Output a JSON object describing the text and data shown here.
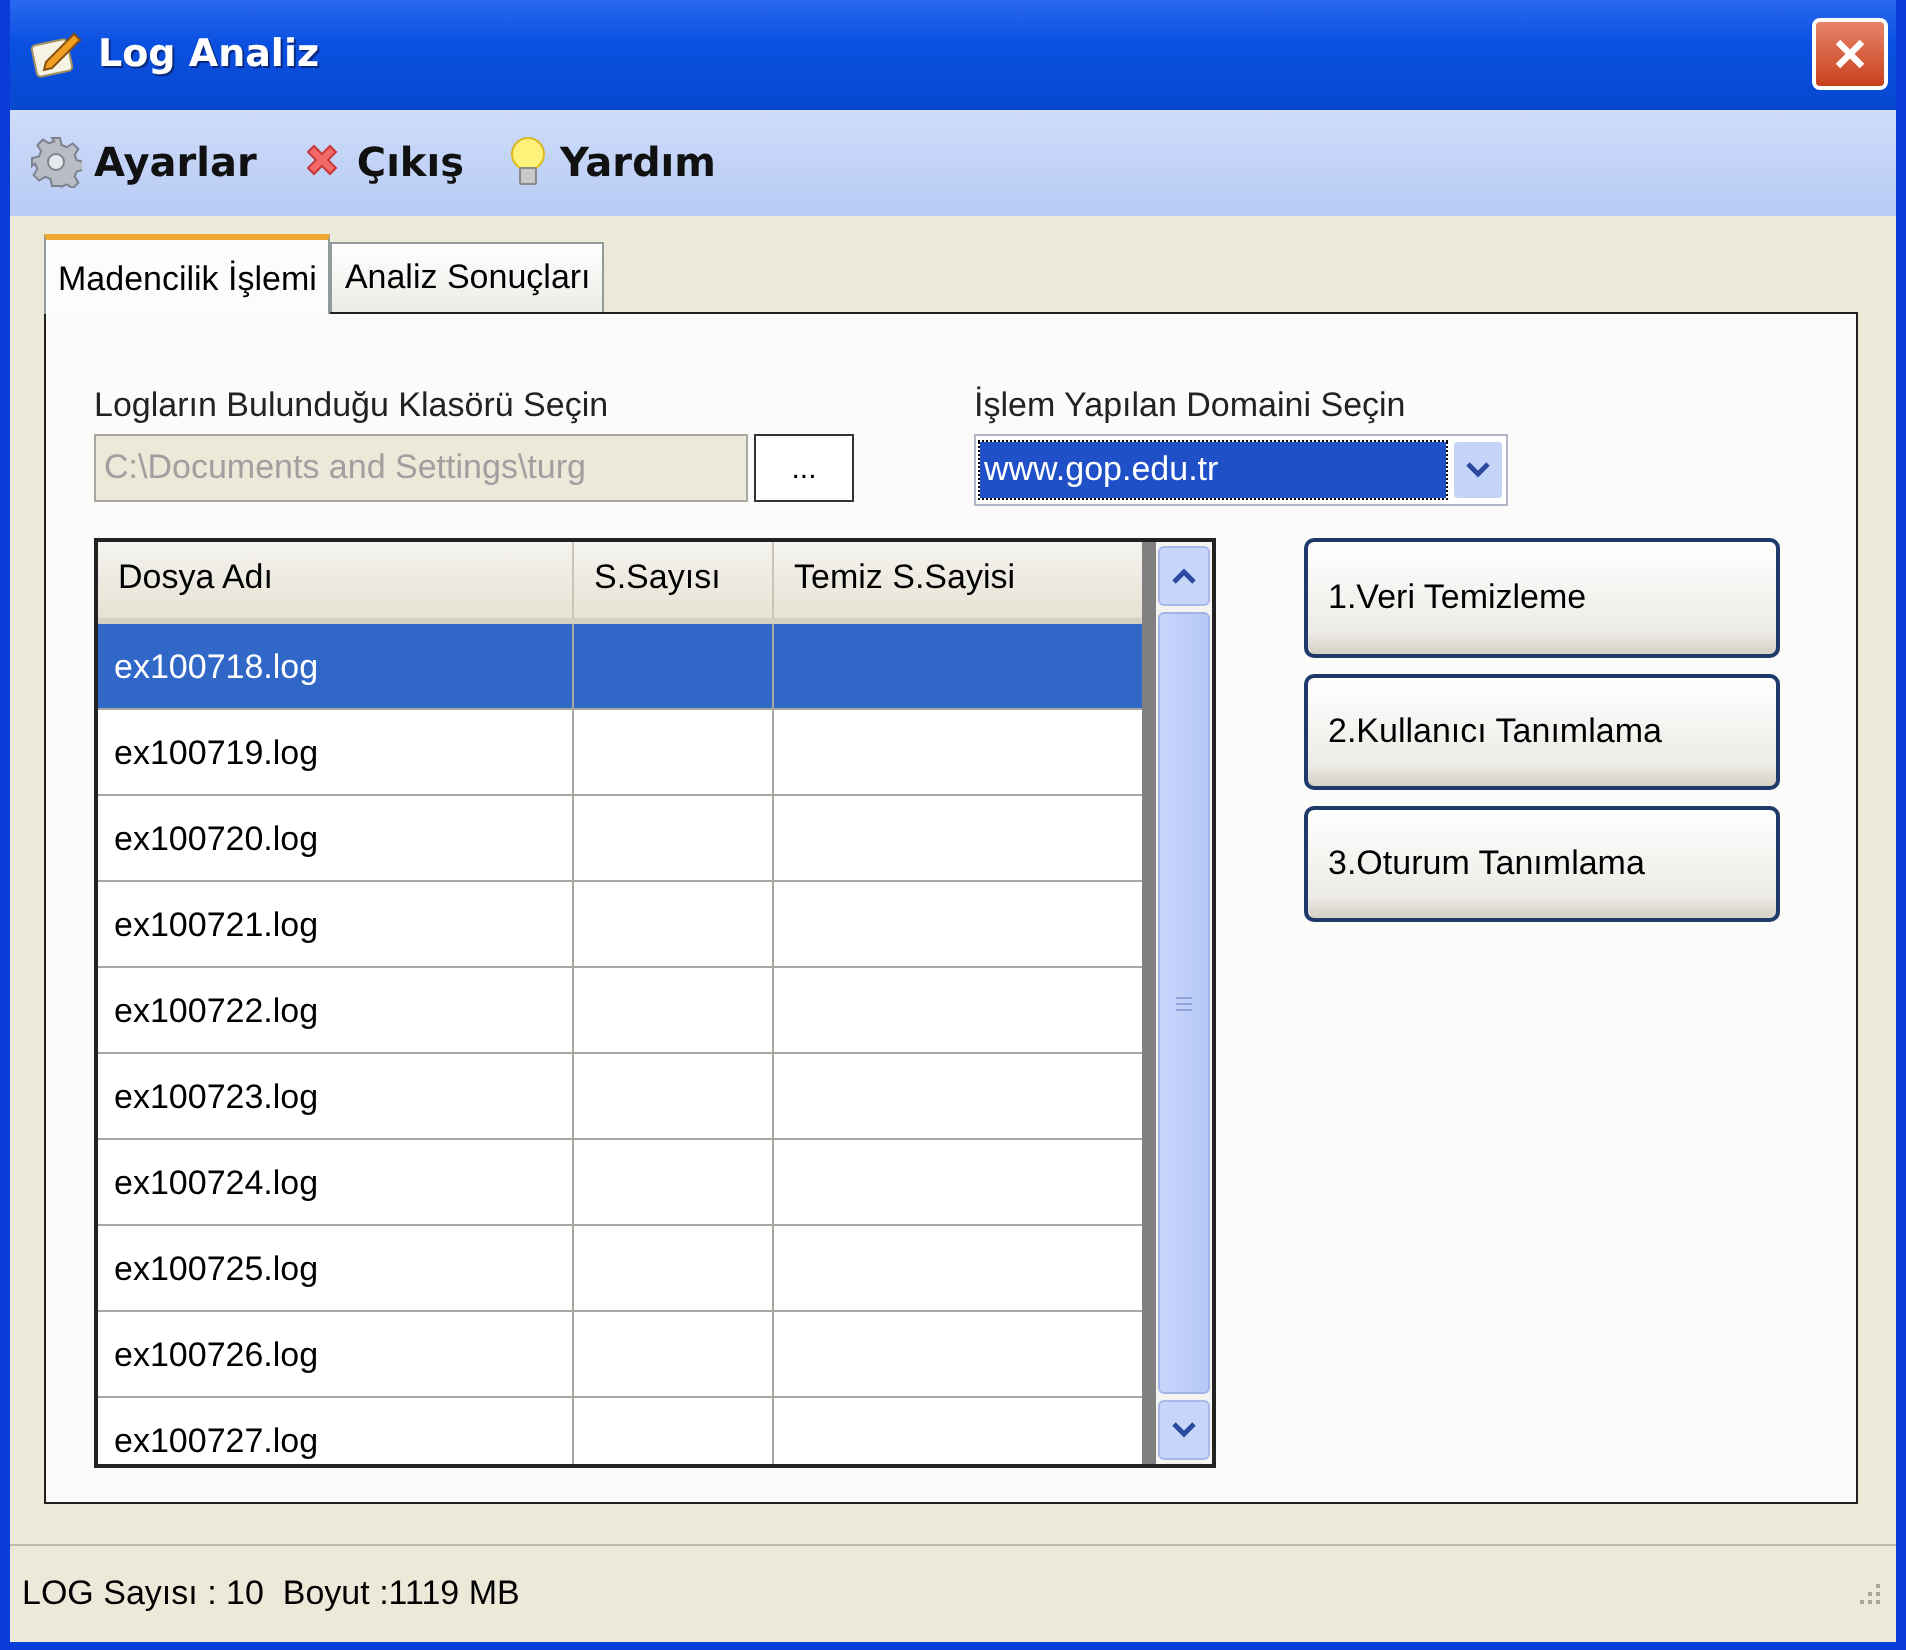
{
  "window": {
    "title": "Log Analiz"
  },
  "menu": [
    {
      "label": "Ayarlar",
      "kind": "settings"
    },
    {
      "label": "Çıkış",
      "kind": "exit"
    },
    {
      "label": "Yardım",
      "kind": "help"
    }
  ],
  "tabs": [
    {
      "label": "Madencilik İşlemi",
      "selected": true
    },
    {
      "label": "Analiz Sonuçları",
      "selected": false
    }
  ],
  "folder": {
    "label": "Logların Bulunduğu Klasörü Seçin",
    "value": "C:\\Documents and Settings\\turg",
    "disabled": true,
    "browse_button": "..."
  },
  "domain": {
    "label": "İşlem Yapılan Domaini Seçin",
    "value": "www.gop.edu.tr"
  },
  "table": {
    "columns": [
      "Dosya Adı",
      "S.Sayısı",
      "Temiz S.Sayisi"
    ],
    "rows": [
      {
        "file": "ex100718.log",
        "selected": true
      },
      {
        "file": "ex100719.log",
        "selected": false
      },
      {
        "file": "ex100720.log",
        "selected": false
      },
      {
        "file": "ex100721.log",
        "selected": false
      },
      {
        "file": "ex100722.log",
        "selected": false
      },
      {
        "file": "ex100723.log",
        "selected": false
      },
      {
        "file": "ex100724.log",
        "selected": false
      },
      {
        "file": "ex100725.log",
        "selected": false
      },
      {
        "file": "ex100726.log",
        "selected": false
      },
      {
        "file": "ex100727.log",
        "selected": false
      }
    ]
  },
  "buttons": [
    "1.Veri Temizleme",
    "2.Kullanıcı Tanımlama",
    "3.Oturum Tanımlama"
  ],
  "status_bar": "LOG Sayısı : 10  Boyut :1119 MB"
}
